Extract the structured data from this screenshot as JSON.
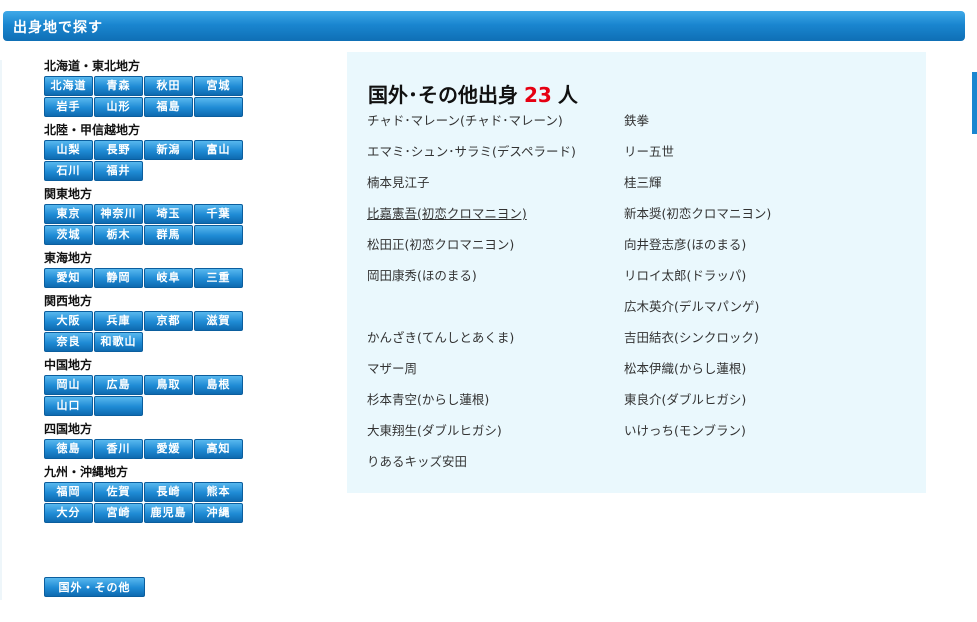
{
  "header": {
    "title": "出身地で探す"
  },
  "regions": [
    {
      "name": "北海道・東北地方",
      "prefs": [
        "北海道",
        "青森",
        "秋田",
        "宮城",
        "岩手",
        "山形",
        "福島",
        ""
      ]
    },
    {
      "name": "北陸・甲信越地方",
      "prefs": [
        "山梨",
        "長野",
        "新潟",
        "富山",
        "石川",
        "福井"
      ]
    },
    {
      "name": "関東地方",
      "prefs": [
        "東京",
        "神奈川",
        "埼玉",
        "千葉",
        "茨城",
        "栃木",
        "群馬",
        ""
      ]
    },
    {
      "name": "東海地方",
      "prefs": [
        "愛知",
        "静岡",
        "岐阜",
        "三重"
      ]
    },
    {
      "name": "関西地方",
      "prefs": [
        "大阪",
        "兵庫",
        "京都",
        "滋賀",
        "奈良",
        "和歌山"
      ]
    },
    {
      "name": "中国地方",
      "prefs": [
        "岡山",
        "広島",
        "鳥取",
        "島根",
        "山口",
        ""
      ]
    },
    {
      "name": "四国地方",
      "prefs": [
        "徳島",
        "香川",
        "愛媛",
        "高知"
      ]
    },
    {
      "name": "九州・沖縄地方",
      "prefs": [
        "福岡",
        "佐賀",
        "長崎",
        "熊本",
        "大分",
        "宮崎",
        "鹿児島",
        "沖縄"
      ]
    }
  ],
  "other_button": "国外・その他",
  "result": {
    "title_prefix": "国外･その他出身",
    "count": "23",
    "title_suffix": "人",
    "left_column": [
      "チャド･マレーン(チャド･マレーン)",
      "エマミ･シュン･サラミ(デスペラード)",
      "楠本見江子",
      "比嘉憲吾(初恋クロマニヨン)",
      "松田正(初恋クロマニヨン)",
      "岡田康秀(ほのまる)",
      "",
      "かんざき(てんしとあくま)",
      "マザー周",
      "杉本青空(からし蓮根)",
      "大東翔生(ダブルヒガシ)",
      "りあるキッズ安田"
    ],
    "right_column": [
      "鉄拳",
      "リー五世",
      "桂三輝",
      "新本奨(初恋クロマニヨン)",
      "向井登志彦(ほのまる)",
      "リロイ太郎(ドラッパ)",
      "広木英介(デルマパンゲ)",
      "吉田結衣(シンクロック)",
      "松本伊織(からし蓮根)",
      "東良介(ダブルヒガシ)",
      "いけっち(モンブラン)"
    ]
  }
}
